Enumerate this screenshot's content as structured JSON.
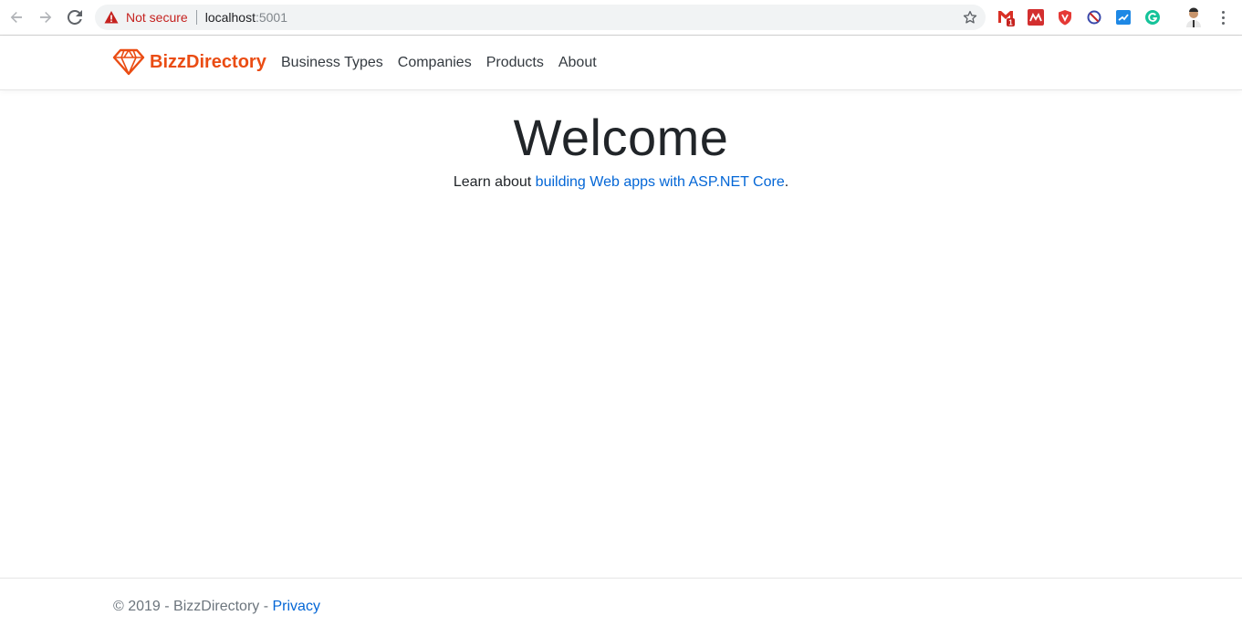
{
  "browser": {
    "security_label": "Not secure",
    "url_host": "localhost",
    "url_port": ":5001",
    "extensions": [
      "gmail-icon",
      "ext-red-icon",
      "shield-icon",
      "block-icon",
      "ext-blue-icon",
      "grammarly-icon"
    ],
    "gmail_badge": "1"
  },
  "navbar": {
    "brand": "BizzDirectory",
    "links": [
      {
        "label": "Business Types"
      },
      {
        "label": "Companies"
      },
      {
        "label": "Products"
      },
      {
        "label": "About"
      }
    ],
    "accent_color": "#ea4c13"
  },
  "main": {
    "title": "Welcome",
    "lead_prefix": "Learn about ",
    "lead_link": "building Web apps with ASP.NET Core",
    "lead_suffix": "."
  },
  "footer": {
    "copyright": "© 2019 - BizzDirectory - ",
    "privacy_link": "Privacy"
  }
}
